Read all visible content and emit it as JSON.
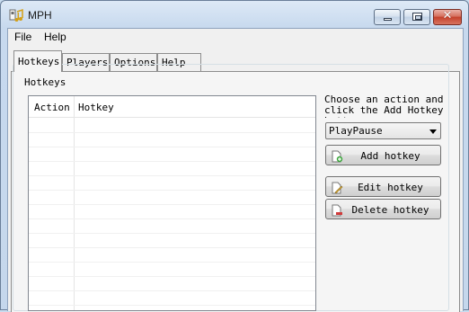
{
  "window": {
    "title": "MPH"
  },
  "menu": {
    "file": "File",
    "help": "Help"
  },
  "tabs": [
    {
      "label": "Hotkeys",
      "active": true
    },
    {
      "label": "Players",
      "active": false
    },
    {
      "label": "Options",
      "active": false
    },
    {
      "label": "Help",
      "active": false
    }
  ],
  "hotkeys_group": {
    "title": "Hotkeys",
    "table": {
      "columns": [
        "Action",
        "Hotkey"
      ],
      "rows": []
    },
    "instruction": "Choose an action and click the Add Hotkey button:",
    "action_select": {
      "value": "PlayPause"
    },
    "buttons": {
      "add": "Add hotkey",
      "edit": "Edit hotkey",
      "delete": "Delete hotkey"
    }
  },
  "icons": {
    "app": "media-player-icon",
    "add": "add-document-icon",
    "edit": "edit-document-icon",
    "delete": "delete-document-icon"
  },
  "colors": {
    "titlebar": "#c7d9ee",
    "close_button": "#c4412b"
  }
}
